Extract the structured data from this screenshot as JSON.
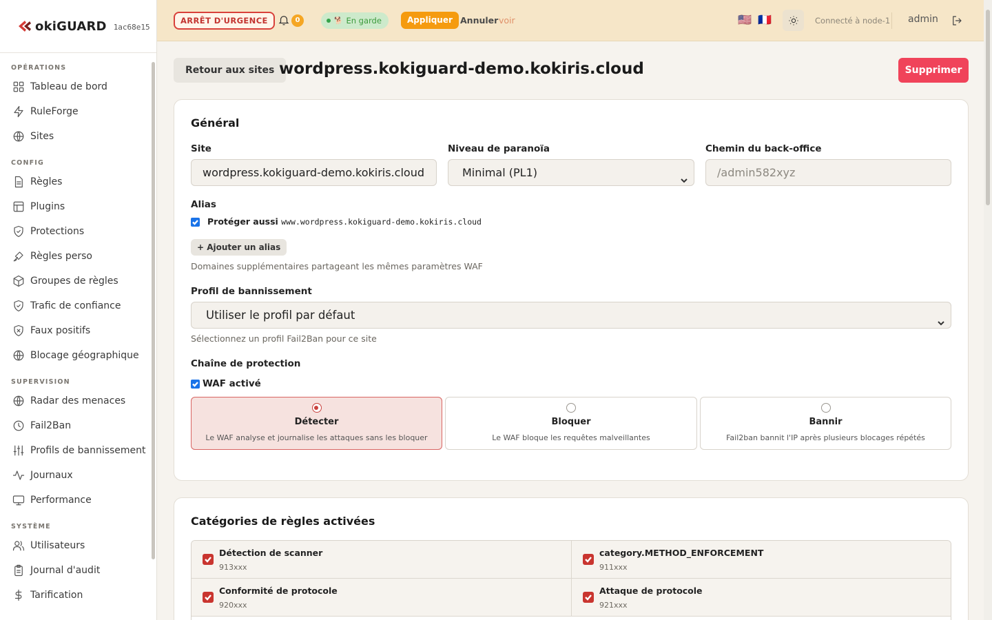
{
  "brand": {
    "name": "okiGUARD",
    "hash": "1ac68e15"
  },
  "sidebar": {
    "sections": [
      {
        "title": "OPÉRATIONS",
        "items": [
          {
            "label": "Tableau de bord",
            "icon": "dashboard-icon"
          },
          {
            "label": "RuleForge",
            "icon": "bolt-icon"
          },
          {
            "label": "Sites",
            "icon": "globe-icon"
          }
        ]
      },
      {
        "title": "CONFIG",
        "items": [
          {
            "label": "Règles",
            "icon": "file-icon"
          },
          {
            "label": "Plugins",
            "icon": "layout-icon"
          },
          {
            "label": "Protections",
            "icon": "shield-check-icon"
          },
          {
            "label": "Règles perso",
            "icon": "brush-icon"
          },
          {
            "label": "Groupes de règles",
            "icon": "box-icon"
          },
          {
            "label": "Trafic de confiance",
            "icon": "shield-check-icon"
          },
          {
            "label": "Faux positifs",
            "icon": "shield-x-icon"
          },
          {
            "label": "Blocage géographique",
            "icon": "globe-icon"
          }
        ]
      },
      {
        "title": "SUPERVISION",
        "items": [
          {
            "label": "Radar des menaces",
            "icon": "globe-icon"
          },
          {
            "label": "Fail2Ban",
            "icon": "clock-icon"
          },
          {
            "label": "Profils de bannissement",
            "icon": "sliders-icon"
          },
          {
            "label": "Journaux",
            "icon": "activity-icon"
          },
          {
            "label": "Performance",
            "icon": "monitor-icon"
          }
        ]
      },
      {
        "title": "SYSTÈME",
        "items": [
          {
            "label": "Utilisateurs",
            "icon": "users-icon"
          },
          {
            "label": "Journal d'audit",
            "icon": "clipboard-icon"
          },
          {
            "label": "Tarification",
            "icon": "dollar-icon"
          }
        ]
      }
    ]
  },
  "topbar": {
    "emergency_label": "ARRÊT D'URGENCE",
    "notifications_count": "0",
    "guard_status": "En garde",
    "apply_label": "Appliquer",
    "cancel_label": "Annuler",
    "view_label": "voir",
    "flags": "🇺🇸 🇫🇷",
    "connected": "Connecté à node-1",
    "user": "admin"
  },
  "page": {
    "back_label": "Retour aux sites",
    "title": "wordpress.kokiguard-demo.kokiris.cloud",
    "delete_label": "Supprimer"
  },
  "general": {
    "title": "Général",
    "site_label": "Site",
    "site_value": "wordpress.kokiguard-demo.kokiris.cloud",
    "paranoia_label": "Niveau de paranoïa",
    "paranoia_value": "Minimal (PL1)",
    "backoffice_label": "Chemin du back-office",
    "backoffice_placeholder": "/admin582xyz",
    "alias_label": "Alias",
    "alias_check_prefix": "Protéger aussi",
    "alias_check_domain": "www.wordpress.kokiguard-demo.kokiris.cloud",
    "alias_checked": true,
    "add_alias_label": "+ Ajouter un alias",
    "alias_help": "Domaines supplémentaires partageant les mêmes paramètres WAF",
    "ban_profile_label": "Profil de bannissement",
    "ban_profile_value": "Utiliser le profil par défaut",
    "ban_profile_help": "Sélectionnez un profil Fail2Ban pour ce site",
    "chain_label": "Chaîne de protection",
    "waf_label": "WAF activé",
    "waf_enabled": true,
    "modes": [
      {
        "title": "Détecter",
        "desc": "Le WAF analyse et journalise les attaques sans les bloquer",
        "selected": true
      },
      {
        "title": "Bloquer",
        "desc": "Le WAF bloque les requêtes malveillantes",
        "selected": false
      },
      {
        "title": "Bannir",
        "desc": "Fail2ban bannit l'IP après plusieurs blocages répétés",
        "selected": false
      }
    ]
  },
  "rules": {
    "title": "Catégories de règles activées",
    "items": [
      {
        "name": "Détection de scanner",
        "code": "913xxx",
        "checked": true
      },
      {
        "name": "category.METHOD_ENFORCEMENT",
        "code": "911xxx",
        "checked": true
      },
      {
        "name": "Conformité de protocole",
        "code": "920xxx",
        "checked": true
      },
      {
        "name": "Attaque de protocole",
        "code": "921xxx",
        "checked": true
      }
    ]
  },
  "colors": {
    "accent": "#f59b0f",
    "danger": "#f0435a",
    "emergency": "#d8403a",
    "topbar_bg": "#f6e6c8",
    "guard_bg": "#cdeacb",
    "mode_active_bg": "#f6e2df"
  }
}
